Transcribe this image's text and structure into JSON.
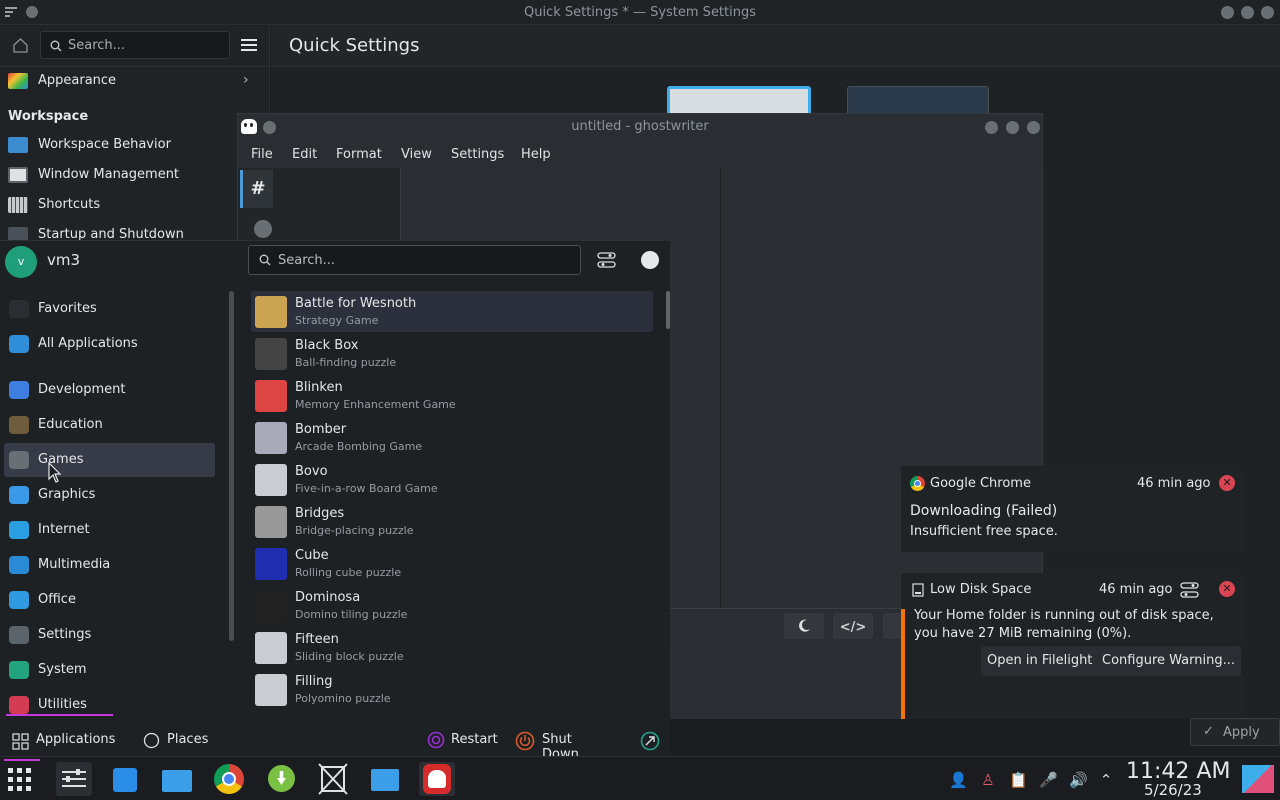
{
  "settings_window": {
    "title": "Quick Settings * — System Settings",
    "search_placeholder": "Search...",
    "page_title": "Quick Settings",
    "sidebar": {
      "appearance": "Appearance",
      "section": "Workspace",
      "items": [
        "Workspace Behavior",
        "Window Management",
        "Shortcuts",
        "Startup and Shutdown"
      ]
    },
    "apply_label": "Apply"
  },
  "ghostwriter": {
    "title": "untitled - ghostwriter",
    "menu": [
      "File",
      "Edit",
      "Format",
      "View",
      "Settings",
      "Help"
    ],
    "hash": "#"
  },
  "launcher": {
    "user": {
      "initial": "v",
      "name": "vm3"
    },
    "search_placeholder": "Search...",
    "categories": [
      {
        "label": "Favorites",
        "icon": "bookmark-icon",
        "color": "#2a2e32"
      },
      {
        "label": "All Applications",
        "icon": "grid-icon",
        "color": "#2f8fd8"
      },
      {
        "label": "Development",
        "icon": "development-icon",
        "color": "#3d7ee0"
      },
      {
        "label": "Education",
        "icon": "education-icon",
        "color": "#6e5c3c"
      },
      {
        "label": "Games",
        "icon": "gamepad-icon",
        "color": "#6a6e75"
      },
      {
        "label": "Graphics",
        "icon": "graphics-icon",
        "color": "#3a9ae8"
      },
      {
        "label": "Internet",
        "icon": "globe-icon",
        "color": "#2a9ee0"
      },
      {
        "label": "Multimedia",
        "icon": "multimedia-icon",
        "color": "#2b8ad6"
      },
      {
        "label": "Office",
        "icon": "office-icon",
        "color": "#2f9ae0"
      },
      {
        "label": "Settings",
        "icon": "settings-icon",
        "color": "#5b636b"
      },
      {
        "label": "System",
        "icon": "system-icon",
        "color": "#24a37f"
      },
      {
        "label": "Utilities",
        "icon": "utilities-icon",
        "color": "#d23b52"
      }
    ],
    "apps": [
      {
        "name": "Battle for Wesnoth",
        "desc": "Strategy Game"
      },
      {
        "name": "Black Box",
        "desc": "Ball-finding puzzle"
      },
      {
        "name": "Blinken",
        "desc": "Memory Enhancement Game"
      },
      {
        "name": "Bomber",
        "desc": "Arcade Bombing Game"
      },
      {
        "name": "Bovo",
        "desc": "Five-in-a-row Board Game"
      },
      {
        "name": "Bridges",
        "desc": "Bridge-placing puzzle"
      },
      {
        "name": "Cube",
        "desc": "Rolling cube puzzle"
      },
      {
        "name": "Dominosa",
        "desc": "Domino tiling puzzle"
      },
      {
        "name": "Fifteen",
        "desc": "Sliding block puzzle"
      },
      {
        "name": "Filling",
        "desc": "Polyomino puzzle"
      }
    ],
    "footer": {
      "applications": "Applications",
      "places": "Places",
      "restart": "Restart",
      "shutdown": "Shut Down"
    }
  },
  "notifications": {
    "chrome": {
      "app": "Google Chrome",
      "time": "46 min ago",
      "title": "Downloading (Failed)",
      "body": "Insufficient free space."
    },
    "disk": {
      "app": "Low Disk Space",
      "time": "46 min ago",
      "body_line1": "Your Home folder is running out of disk space,",
      "body_line2": "you have 27 MiB remaining (0%).",
      "btn_open": "Open in Filelight",
      "btn_configure": "Configure Warning..."
    }
  },
  "taskbar": {
    "time": "11:42 AM",
    "date": "5/26/23"
  }
}
